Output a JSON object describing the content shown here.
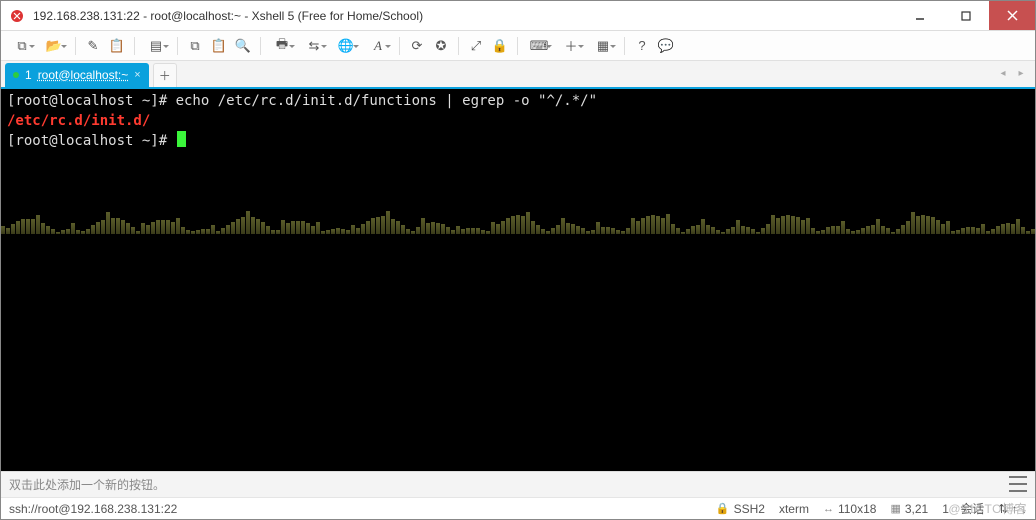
{
  "window": {
    "title": "192.168.238.131:22 - root@localhost:~ - Xshell 5 (Free for Home/School)"
  },
  "tabs": {
    "active": {
      "index": "1",
      "label": "root@localhost:~"
    }
  },
  "terminal": {
    "line1": "[root@localhost ~]# echo /etc/rc.d/init.d/functions | egrep -o \"^/.*/\"",
    "line2": "/etc/rc.d/init.d/",
    "line3_prompt": "[root@localhost ~]# "
  },
  "hint": "双击此处添加一个新的按钮。",
  "status": {
    "conn": "ssh://root@192.168.238.131:22",
    "proto": "SSH2",
    "term": "xterm",
    "size": "110x18",
    "pos": "3,21",
    "sessions_label": "会话",
    "sessions_count": "1",
    "arrows": "⇅  ↑  ↓"
  },
  "watermark": "@51CTO博客",
  "icons": {
    "new": "⧉",
    "open": "📂",
    "brush": "✎",
    "paste": "📋",
    "props": "▤",
    "copy": "⧉",
    "clipboard": "📋",
    "search": "🔍",
    "print": "🖶",
    "transfer": "⇆",
    "globe": "🌐",
    "font": "A",
    "reload": "⟳",
    "compass": "✪",
    "fullscreen": "⤢",
    "lock": "🔒",
    "keyboard": "⌨",
    "add": "＋",
    "grid": "▦",
    "help": "?",
    "chat": "💬"
  }
}
